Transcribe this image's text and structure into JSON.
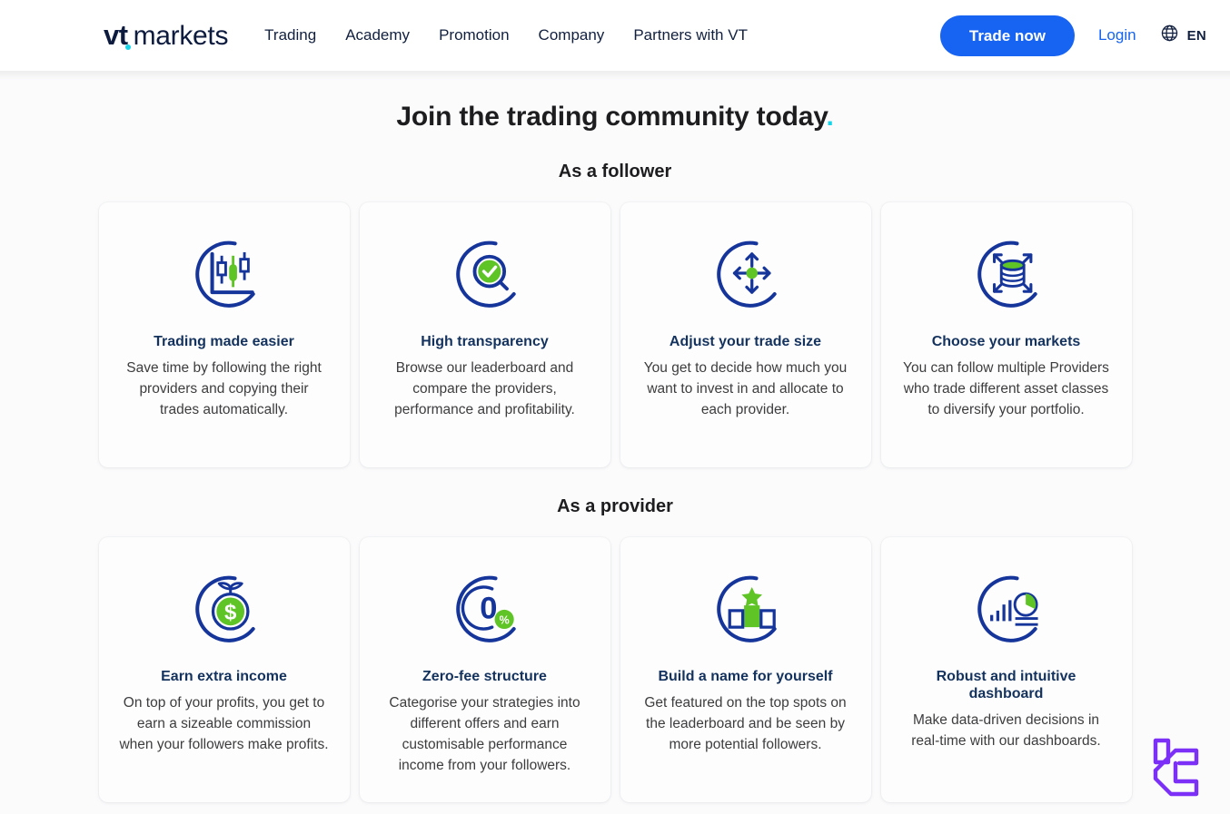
{
  "header": {
    "logo": {
      "vt": "vt",
      "markets": "markets"
    },
    "nav": [
      {
        "label": "Trading"
      },
      {
        "label": "Academy"
      },
      {
        "label": "Promotion"
      },
      {
        "label": "Company"
      },
      {
        "label": "Partners with VT"
      }
    ],
    "trade_button": "Trade now",
    "login": "Login",
    "language": "EN",
    "globe_icon": "globe-icon",
    "accent_blue": "#1763f2",
    "accent_cyan": "#17d5e8"
  },
  "main": {
    "title": "Join the trading community today",
    "title_dot": ".",
    "follower_label": "As a follower",
    "provider_label": "As a provider",
    "follower_cards": [
      {
        "icon": "candlestick-chart-icon",
        "title": "Trading made easier",
        "text": "Save time by following the right providers and copying their trades automatically."
      },
      {
        "icon": "magnifier-check-icon",
        "title": "High transparency",
        "text": "Browse our leaderboard and compare the providers, performance and profitability."
      },
      {
        "icon": "four-arrows-resize-icon",
        "title": "Adjust your trade size",
        "text": "You get to decide how much you want to invest in and allocate to each provider."
      },
      {
        "icon": "database-diversify-icon",
        "title": "Choose your markets",
        "text": "You can follow multiple Providers who trade different asset classes to diversify your portfolio."
      }
    ],
    "provider_cards": [
      {
        "icon": "money-growth-icon",
        "title": "Earn extra income",
        "text": "On top of your profits, you get to earn a sizeable commission when your followers make profits."
      },
      {
        "icon": "zero-percent-icon",
        "title": "Zero-fee structure",
        "text": "Categorise your strategies into different offers and earn customisable performance income from your followers."
      },
      {
        "icon": "podium-star-icon",
        "title": "Build a name for yourself",
        "text": "Get featured on the top spots on the leaderboard and be seen by more potential followers."
      },
      {
        "icon": "dashboard-analytics-icon",
        "title": "Robust and intuitive dashboard",
        "text": "Make data-driven decisions in real-time with our dashboards."
      }
    ]
  },
  "float_widget": {
    "icon": "lc-logo-icon",
    "color": "#7b2ff7"
  }
}
